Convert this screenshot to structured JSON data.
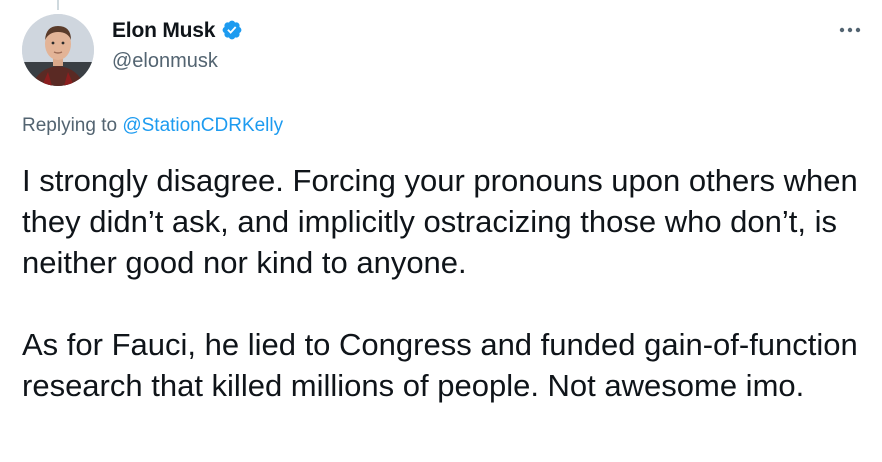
{
  "tweet": {
    "author": {
      "display_name": "Elon Musk",
      "handle": "@elonmusk",
      "verified": true,
      "avatar_icon": "profile-photo"
    },
    "more_icon": "more-horizontal-icon",
    "replying_prefix": "Replying to ",
    "replying_to": "@StationCDRKelly",
    "paragraphs": [
      "I strongly disagree. Forcing your pronouns upon others when they didn’t ask, and implicitly ostracizing those who don’t, is neither good nor kind to anyone.",
      "As for Fauci, he lied to Congress and funded gain-of-function research that killed millions of people. Not awesome imo."
    ]
  },
  "colors": {
    "accent": "#1d9bf0",
    "text": "#0f1419",
    "secondary_text": "#536471",
    "thread_line": "#cfd9de"
  }
}
